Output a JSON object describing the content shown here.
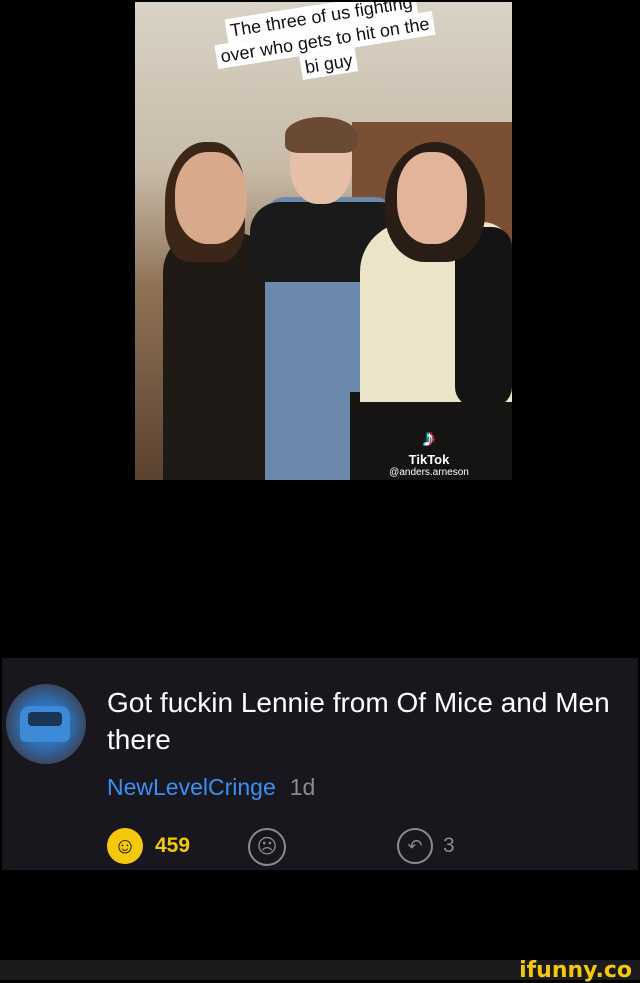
{
  "video": {
    "caption_lines": [
      "The three of us fighting",
      "over who gets to hit on the",
      "bi guy"
    ],
    "watermark": {
      "icon": "tiktok-logo-icon",
      "name": "TikTok",
      "handle": "@anders.arneson"
    }
  },
  "comment": {
    "avatar": "car-avatar",
    "text": "Got fuckin Lennie from Of Mice and Men there",
    "username": "NewLevelCringe",
    "age": "1d",
    "smiles": "459",
    "replies": "3",
    "icons": {
      "smile": "smile-icon",
      "unsmile": "frown-icon",
      "reply": "reply-icon"
    },
    "colors": {
      "background": "#17171d",
      "username": "#3b8ff5",
      "smile": "#f6c80b",
      "muted": "#8a8a92"
    }
  },
  "footer": {
    "brand": "ifunny.co"
  }
}
